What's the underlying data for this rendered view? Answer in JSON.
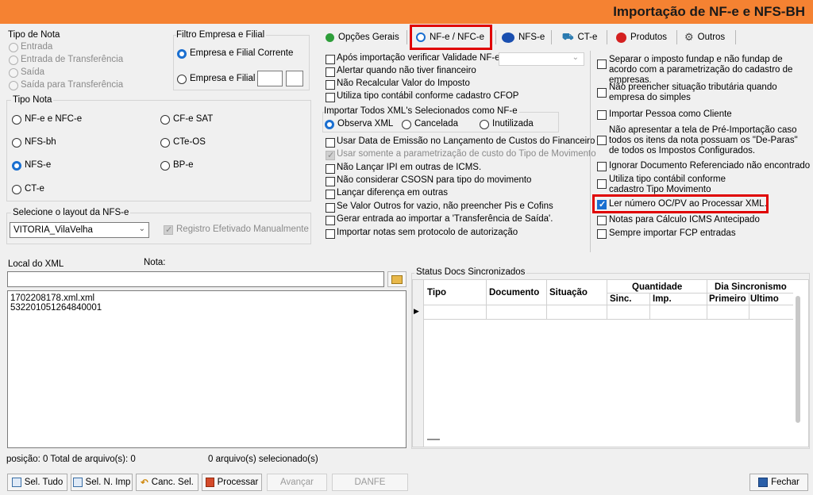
{
  "title": "Importação de NF-e e NFS-BH",
  "tipo_nota_top": {
    "label": "Tipo de Nota",
    "options": [
      "Entrada",
      "Entrada de Transferência",
      "Saída",
      "Saída para Transferência"
    ]
  },
  "filtro": {
    "label": "Filtro Empresa e Filial",
    "opt1": "Empresa e Filial Corrente",
    "opt2": "Empresa e Filial :"
  },
  "tipo_nota": {
    "label": "Tipo Nota",
    "options": [
      "NF-e e NFC-e",
      "CF-e SAT",
      "NFS-bh",
      "CTe-OS",
      "NFS-e",
      "BP-e",
      "CT-e"
    ]
  },
  "layout": {
    "label": "Selecione o layout da NFS-e",
    "value": "VITORIA_VilaVelha",
    "registro_label": "Registro Efetivado Manualmente"
  },
  "tabs": [
    "Opções Gerais",
    "NF-e / NFC-e",
    "NFS-e",
    "CT-e",
    "Produtos",
    "Outros"
  ],
  "options_mid": {
    "items": [
      "Após importação verificar Validade NF-e",
      "Alertar quando não tiver financeiro",
      "Não Recalcular Valor do Imposto",
      "Utiliza tipo contábil conforme cadastro CFOP"
    ],
    "import_group_label": "Importar Todos XML's Selecionados como NF-e",
    "import_opts": [
      "Observa XML",
      "Cancelada",
      "Inutilizada"
    ],
    "items2": [
      "Usar Data de Emissão no Lançamento de Custos do Financeiro",
      "Usar somente a parametrização de custo do Tipo de Movimento",
      "Não Lançar IPI em outras de ICMS.",
      "Não considerar CSOSN para tipo do movimento",
      "Lançar diferença em outras",
      "Se Valor Outros for vazio, não preencher Pis e Cofins",
      "Gerar entrada ao importar a 'Transferência de Saída'.",
      "Importar notas sem protocolo de autorização"
    ]
  },
  "options_right": [
    "Separar o imposto fundap e não fundap de acordo com a parametrização do cadastro de empresas.",
    "Não preencher situação tributária quando empresa do simples",
    "Importar Pessoa como Cliente",
    "Não apresentar a tela de Pré-Importação caso todos os itens da nota possuam os \"De-Paras\" de todos os Impostos Configurados.",
    "Ignorar Documento Referenciado não encontrado",
    "Utiliza tipo contábil conforme cadastro Tipo Movimento",
    "Ler número OC/PV ao Processar XML.",
    "Notas para Cálculo ICMS Antecipado",
    "Sempre importar FCP entradas"
  ],
  "local": {
    "label": "Local do XML",
    "nota_label": "Nota:",
    "files": [
      "1702208178.xml.xml",
      "532201051264840001"
    ]
  },
  "status": {
    "label": "Status Docs Sincronizados",
    "headers": {
      "tipo": "Tipo",
      "documento": "Documento",
      "situacao": "Situação",
      "quantidade": "Quantidade",
      "sinc": "Sinc.",
      "imp": "Imp.",
      "dia": "Dia Sincronismo",
      "primeiro": "Primeiro",
      "ultimo": "Ultimo"
    }
  },
  "footer": {
    "posicao": "posição: 0  Total de arquivo(s): 0",
    "selecionados": "0 arquivo(s) selecionado(s)"
  },
  "buttons": {
    "sel_tudo": "Sel. Tudo",
    "sel_n_imp": "Sel. N. Imp",
    "canc_sel": "Canc. Sel.",
    "processar": "Processar",
    "avancar": "Avançar",
    "danfe": "DANFE",
    "fechar": "Fechar"
  }
}
